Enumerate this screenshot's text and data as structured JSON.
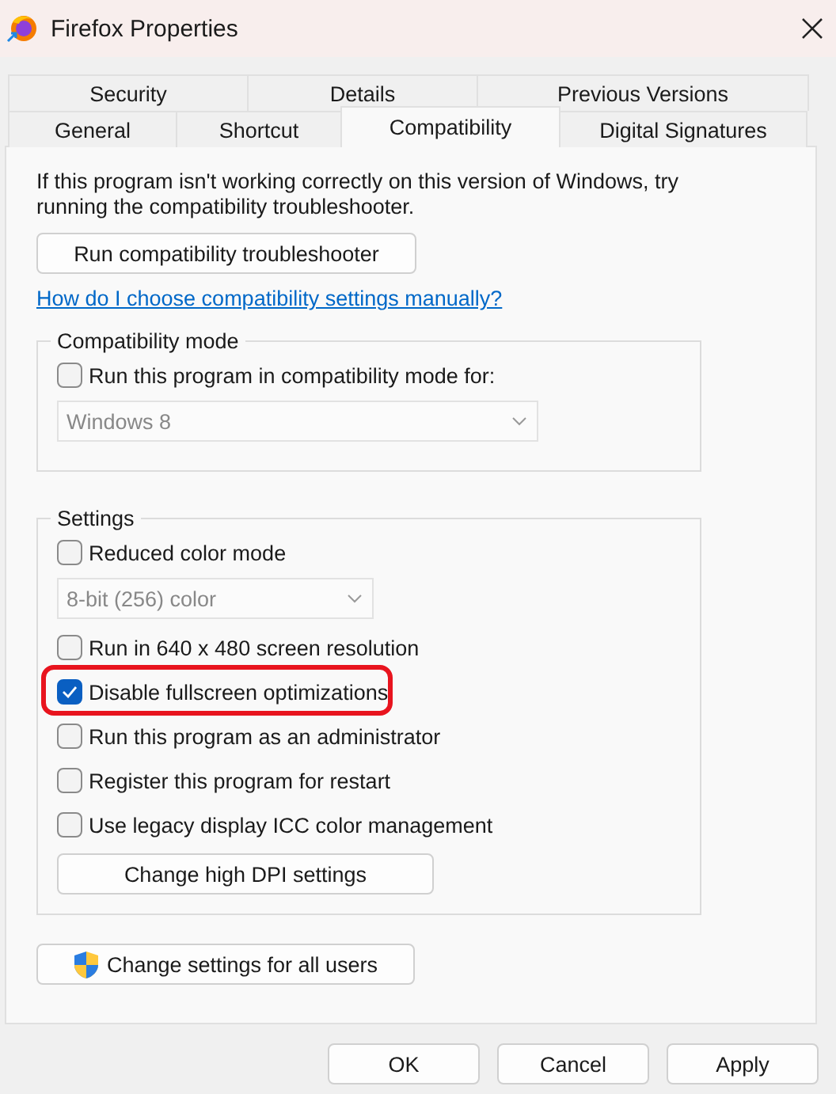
{
  "window": {
    "title": "Firefox Properties"
  },
  "tab_rows": [
    {
      "tabs": [
        {
          "label": "Security",
          "selected": false
        },
        {
          "label": "Details",
          "selected": false
        },
        {
          "label": "Previous Versions",
          "selected": false
        }
      ]
    },
    {
      "tabs": [
        {
          "label": "General",
          "selected": false
        },
        {
          "label": "Shortcut",
          "selected": false
        },
        {
          "label": "Compatibility",
          "selected": true
        },
        {
          "label": "Digital Signatures",
          "selected": false
        }
      ]
    }
  ],
  "intro": "If this program isn't working correctly on this version of Windows, try running the compatibility troubleshooter.",
  "troubleshooter_button": "Run compatibility troubleshooter",
  "help_link": "How do I choose compatibility settings manually?",
  "compatibility_mode": {
    "title": "Compatibility mode",
    "items": [
      {
        "kind": "checkbox",
        "label": "Run this program in compatibility mode for:",
        "checked": false,
        "highlighted": false
      },
      {
        "kind": "select",
        "value": "Windows 8",
        "disabled": true
      }
    ]
  },
  "settings": {
    "title": "Settings",
    "items": [
      {
        "kind": "checkbox",
        "label": "Reduced color mode",
        "checked": false,
        "highlighted": false
      },
      {
        "kind": "select",
        "value": "8-bit (256) color",
        "disabled": true
      },
      {
        "kind": "checkbox",
        "label": "Run in 640 x 480 screen resolution",
        "checked": false,
        "highlighted": false
      },
      {
        "kind": "checkbox",
        "label": "Disable fullscreen optimizations",
        "checked": true,
        "highlighted": true
      },
      {
        "kind": "checkbox",
        "label": "Run this program as an administrator",
        "checked": false,
        "highlighted": false
      },
      {
        "kind": "checkbox",
        "label": "Register this program for restart",
        "checked": false,
        "highlighted": false
      },
      {
        "kind": "checkbox",
        "label": "Use legacy display ICC color management",
        "checked": false,
        "highlighted": false
      }
    ],
    "dpi_button": "Change high DPI settings"
  },
  "all_users_button": "Change settings for all users",
  "buttons": [
    "OK",
    "Cancel",
    "Apply"
  ]
}
